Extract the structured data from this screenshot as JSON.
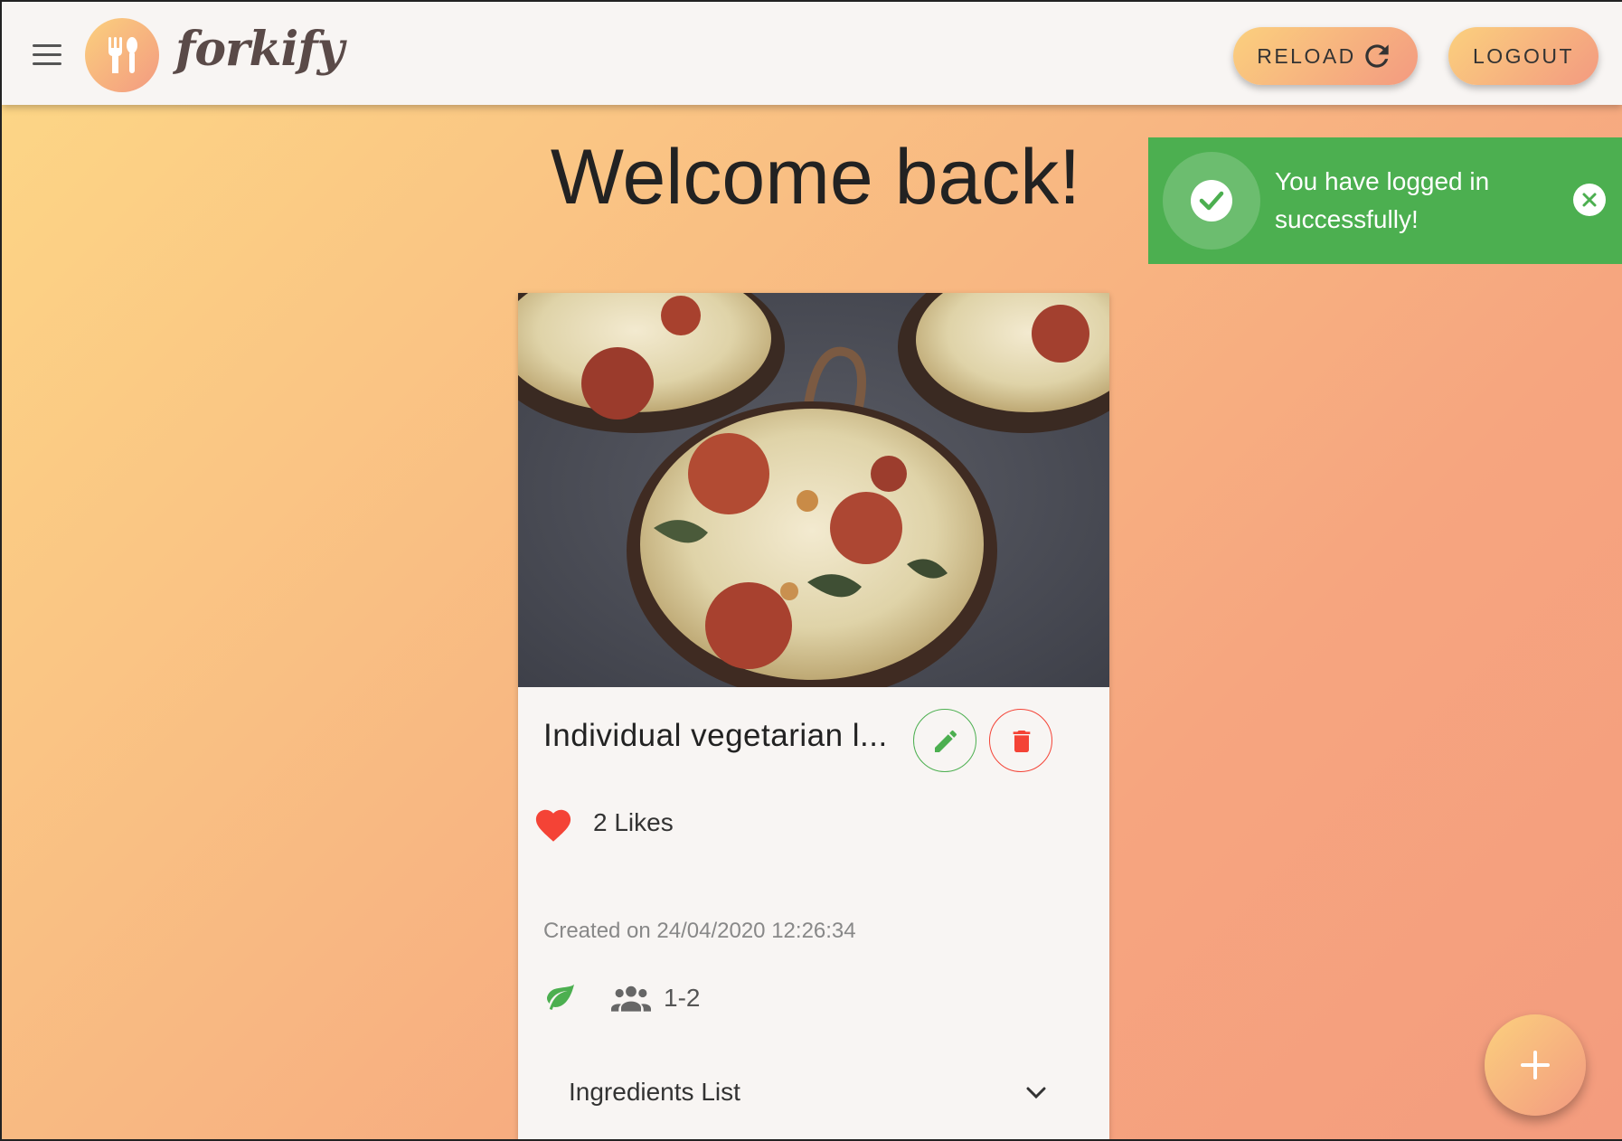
{
  "header": {
    "logo_text": "forkify",
    "reload_label": "RELOAD",
    "logout_label": "LOGOUT"
  },
  "main": {
    "title": "Welcome back!"
  },
  "toast": {
    "message": "You have logged in successfully!",
    "color": "#4caf50"
  },
  "recipe": {
    "title": "Individual vegetarian l...",
    "likes": "2 Likes",
    "created": "Created on 24/04/2020 12:26:34",
    "servings": "1-2",
    "ingredients_label": "Ingredients List"
  },
  "colors": {
    "accent_start": "#fbd07e",
    "accent_end": "#f39a80",
    "success": "#4caf50",
    "danger": "#f44336"
  }
}
